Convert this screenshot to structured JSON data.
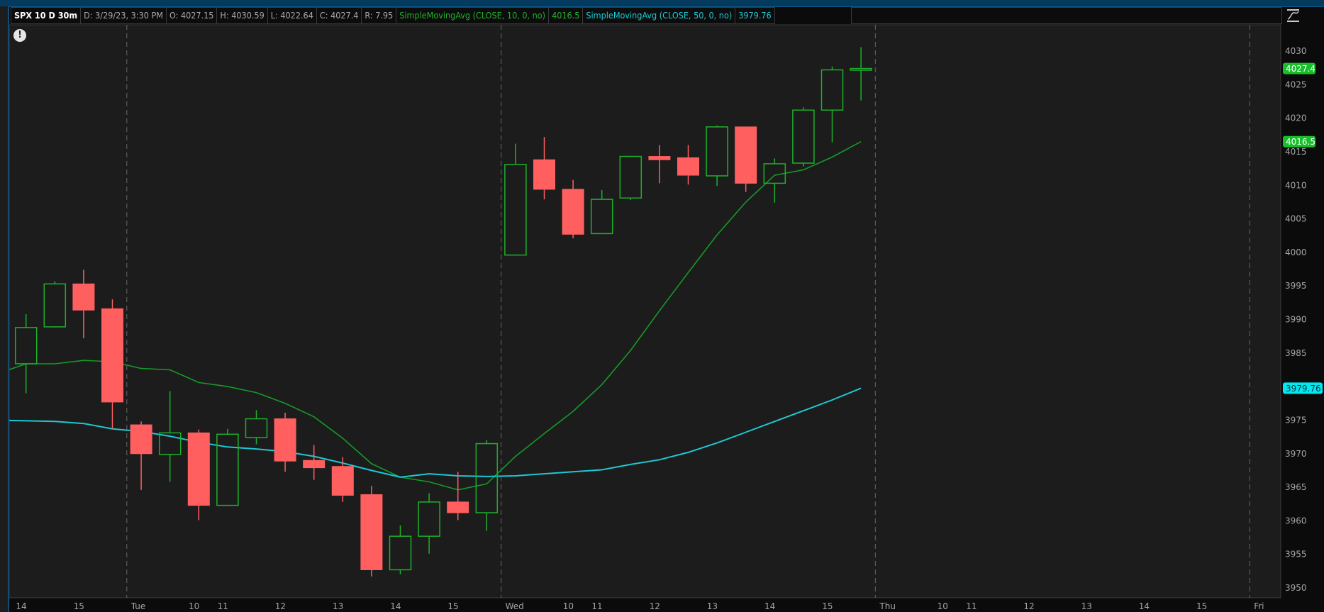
{
  "header": {
    "symbol": "SPX 10 D 30m",
    "date": "D: 3/29/23, 3:30 PM",
    "open": "O: 4027.15",
    "high": "H: 4030.59",
    "low": "L: 4022.64",
    "close": "C: 4027.4",
    "range": "R: 7.95",
    "sma10_label": "SimpleMovingAvg (CLOSE, 10, 0, no)",
    "sma10_value": "4016.5",
    "sma50_label": "SimpleMovingAvg (CLOSE, 50, 0, no)",
    "sma50_value": "3979.76"
  },
  "alert_icon": "!",
  "colors": {
    "up": "#1db02b",
    "down": "#ff5f5f",
    "sma10": "#159a28",
    "sma50": "#1cc8d3",
    "badge_green": "#17c02a",
    "badge_cyan": "#00e8f0"
  },
  "chart_data": {
    "type": "candlestick",
    "title": "SPX 10 D 30m",
    "ylim": [
      3950,
      4030
    ],
    "yticks": [
      "4030",
      "4025",
      "4020",
      "4015",
      "4010",
      "4005",
      "4000",
      "3995",
      "3990",
      "3985",
      "3980",
      "3975",
      "3970",
      "3965",
      "3960",
      "3955",
      "3950"
    ],
    "bars_per_day": 13,
    "first_bar_index": 9,
    "candles": [
      [
        3983.4,
        3990.8,
        3979.0,
        3988.8
      ],
      [
        3988.9,
        3995.7,
        3988.8,
        3995.3
      ],
      [
        3995.3,
        3997.4,
        3987.2,
        3991.4
      ],
      [
        3991.6,
        3993.0,
        3973.7,
        3977.7
      ],
      [
        3974.3,
        3974.8,
        3964.6,
        3970.0
      ],
      [
        3969.9,
        3979.3,
        3965.8,
        3973.1
      ],
      [
        3973.1,
        3973.6,
        3960.1,
        3962.3
      ],
      [
        3962.3,
        3973.7,
        3962.2,
        3972.9
      ],
      [
        3972.4,
        3976.5,
        3971.4,
        3975.2
      ],
      [
        3975.2,
        3976.1,
        3967.3,
        3968.9
      ],
      [
        3969.0,
        3971.3,
        3966.1,
        3967.9
      ],
      [
        3968.1,
        3969.5,
        3962.8,
        3963.8
      ],
      [
        3963.9,
        3965.2,
        3951.7,
        3952.7
      ],
      [
        3952.7,
        3959.3,
        3952.0,
        3957.7
      ],
      [
        3957.7,
        3964.1,
        3955.1,
        3962.8
      ],
      [
        3962.8,
        3967.3,
        3960.1,
        3961.2
      ],
      [
        3961.2,
        3972.0,
        3958.5,
        3971.5
      ],
      [
        3999.6,
        4016.2,
        3999.6,
        4013.1
      ],
      [
        4013.8,
        4017.2,
        4007.9,
        4009.4
      ],
      [
        4009.4,
        4010.8,
        4002.1,
        4002.7
      ],
      [
        4002.8,
        4009.3,
        4002.7,
        4007.9
      ],
      [
        4008.1,
        4014.4,
        4007.8,
        4014.3
      ],
      [
        4014.3,
        4016.0,
        4010.3,
        4013.8
      ],
      [
        4014.1,
        4016.0,
        4010.1,
        4011.5
      ],
      [
        4011.4,
        4018.9,
        4009.9,
        4018.7
      ],
      [
        4018.7,
        4018.7,
        4009.0,
        4010.3
      ],
      [
        4010.3,
        4014.0,
        4007.4,
        4013.2
      ],
      [
        4013.3,
        4021.6,
        4012.8,
        4021.2
      ],
      [
        4021.2,
        4027.7,
        4016.4,
        4027.2
      ],
      [
        4027.15,
        4030.59,
        4022.64,
        4027.4
      ]
    ],
    "series": [
      {
        "name": "SimpleMovingAvg (CLOSE, 10, 0, no)",
        "start_index": 8,
        "values": [
          3981.9,
          3983.4,
          3983.4,
          3983.9,
          3983.7,
          3982.7,
          3982.5,
          3980.6,
          3980.0,
          3979.1,
          3977.5,
          3975.5,
          3972.3,
          3968.5,
          3966.5,
          3965.8,
          3964.6,
          3965.5,
          3969.6,
          3973.0,
          3976.3,
          3980.3,
          3985.4,
          3991.3,
          3997.0,
          4002.6,
          4007.5,
          4011.5,
          4012.3,
          4014.2,
          4016.5
        ]
      },
      {
        "name": "SimpleMovingAvg (CLOSE, 50, 0, no)",
        "start_index": 8,
        "values": [
          3975.0,
          3974.9,
          3974.8,
          3974.5,
          3973.7,
          3973.3,
          3972.6,
          3971.7,
          3971.0,
          3970.7,
          3970.3,
          3969.6,
          3968.6,
          3967.5,
          3966.5,
          3967.0,
          3966.7,
          3966.6,
          3966.7,
          3967.0,
          3967.3,
          3967.6,
          3968.4,
          3969.1,
          3970.2,
          3971.6,
          3973.2,
          3974.8,
          3976.4,
          3978.0,
          3979.76
        ]
      }
    ],
    "price_badges": [
      {
        "label": "4027.4",
        "value": 4027.4,
        "kind": "green"
      },
      {
        "label": "4016.5",
        "value": 4016.5,
        "kind": "green"
      },
      {
        "label": "3979.76",
        "value": 3979.76,
        "kind": "cyan"
      }
    ],
    "day_separators": [
      1,
      2,
      3,
      4
    ],
    "xticks": [
      {
        "label": "14",
        "bar": 9
      },
      {
        "label": "15",
        "bar": 11
      },
      {
        "label": "Tue",
        "bar": 13
      },
      {
        "label": "10",
        "bar": 15
      },
      {
        "label": "11",
        "bar": 16
      },
      {
        "label": "12",
        "bar": 18
      },
      {
        "label": "13",
        "bar": 20
      },
      {
        "label": "14",
        "bar": 22
      },
      {
        "label": "15",
        "bar": 24
      },
      {
        "label": "Wed",
        "bar": 26
      },
      {
        "label": "10",
        "bar": 28
      },
      {
        "label": "11",
        "bar": 29
      },
      {
        "label": "12",
        "bar": 31
      },
      {
        "label": "13",
        "bar": 33
      },
      {
        "label": "14",
        "bar": 35
      },
      {
        "label": "15",
        "bar": 37
      },
      {
        "label": "Thu",
        "bar": 39
      },
      {
        "label": "10",
        "bar": 41
      },
      {
        "label": "11",
        "bar": 42
      },
      {
        "label": "12",
        "bar": 44
      },
      {
        "label": "13",
        "bar": 46
      },
      {
        "label": "14",
        "bar": 48
      },
      {
        "label": "15",
        "bar": 50
      },
      {
        "label": "Fri",
        "bar": 52
      }
    ]
  }
}
